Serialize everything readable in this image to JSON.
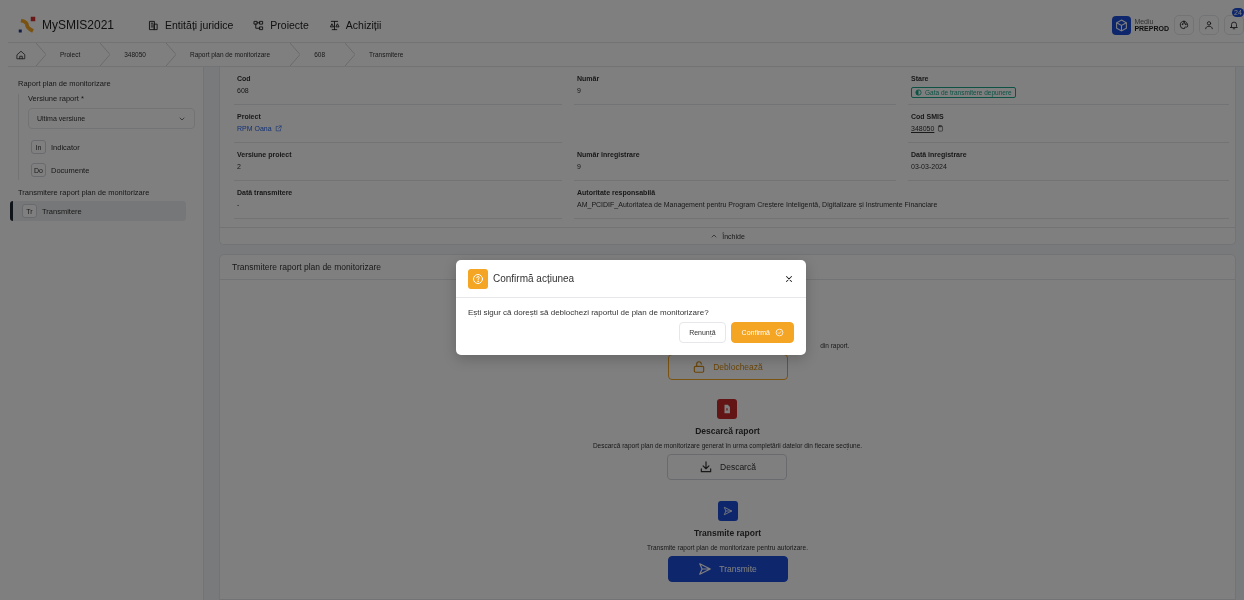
{
  "header": {
    "app_name": "MySMIS2021",
    "nav": [
      {
        "kind": "building",
        "label": "Entități juridice"
      },
      {
        "kind": "nodes",
        "label": "Proiecte"
      },
      {
        "kind": "scale",
        "label": "Achiziții"
      }
    ],
    "environment": {
      "label": "Mediu",
      "value": "PREPROD"
    },
    "notification_count": "24"
  },
  "breadcrumb": [
    "Proiect",
    "348050",
    "Raport plan de monitorizare",
    "608",
    "Transmitere"
  ],
  "sidebar": {
    "sections": [
      {
        "title": "Raport plan de monitorizare",
        "field": {
          "label": "Versiune raport *",
          "value": "Ultima versiune"
        },
        "items": [
          {
            "abbr": "In",
            "label": "Indicator",
            "selected": false
          },
          {
            "abbr": "Do",
            "label": "Documente",
            "selected": false
          }
        ]
      },
      {
        "title": "Transmitere raport plan de monitorizare",
        "items": [
          {
            "abbr": "Tr",
            "label": "Transmitere",
            "selected": true
          }
        ]
      }
    ]
  },
  "details": {
    "rows": [
      [
        {
          "label": "Cod",
          "value": "608",
          "kind": "text"
        },
        {
          "label": "Număr",
          "value": "9",
          "kind": "text"
        },
        {
          "label": "Stare",
          "value": "Gata de transmitere depunere",
          "kind": "badge"
        }
      ],
      [
        {
          "label": "Proiect",
          "value": "RPM Oana",
          "kind": "link"
        },
        {
          "label": "Cod SMIS",
          "value": "348050",
          "kind": "copy"
        }
      ],
      [
        {
          "label": "Versiune proiect",
          "value": "2",
          "kind": "text"
        },
        {
          "label": "Număr înregistrare",
          "value": "9",
          "kind": "text"
        },
        {
          "label": "Dată înregistrare",
          "value": "03-03-2024",
          "kind": "text"
        }
      ],
      [
        {
          "label": "Dată transmitere",
          "value": "-",
          "kind": "text"
        },
        {
          "label": "Autoritate responsabilă",
          "value": "AM_PCIDIF_Autoritatea de Management pentru Program Creștere Inteligentă, Digitalizare și Instrumente Financiare",
          "kind": "wide"
        }
      ]
    ],
    "collapse_label": "Închide"
  },
  "transmit_panel": {
    "title": "Transmitere raport plan de monitorizare",
    "actions": [
      {
        "kind": "unlock",
        "description": "din raport.",
        "button": "Deblochează"
      },
      {
        "kind": "download",
        "title": "Descarcă raport",
        "description": "Descarcă raport plan de monitorizare generat în urma completării datelor din fiecare secțiune.",
        "button": "Descarcă"
      },
      {
        "kind": "transmit",
        "title": "Transmite raport",
        "description": "Transmite raport plan de monitorizare pentru autorizare.",
        "button": "Transmite"
      }
    ]
  },
  "modal": {
    "title": "Confirmă acțiunea",
    "message": "Ești sigur că dorești să deblochezi raportul de plan de monitorizare?",
    "buttons": [
      {
        "label": "Renunță",
        "kind": "secondary"
      },
      {
        "label": "Confirmă",
        "kind": "primary"
      }
    ]
  }
}
